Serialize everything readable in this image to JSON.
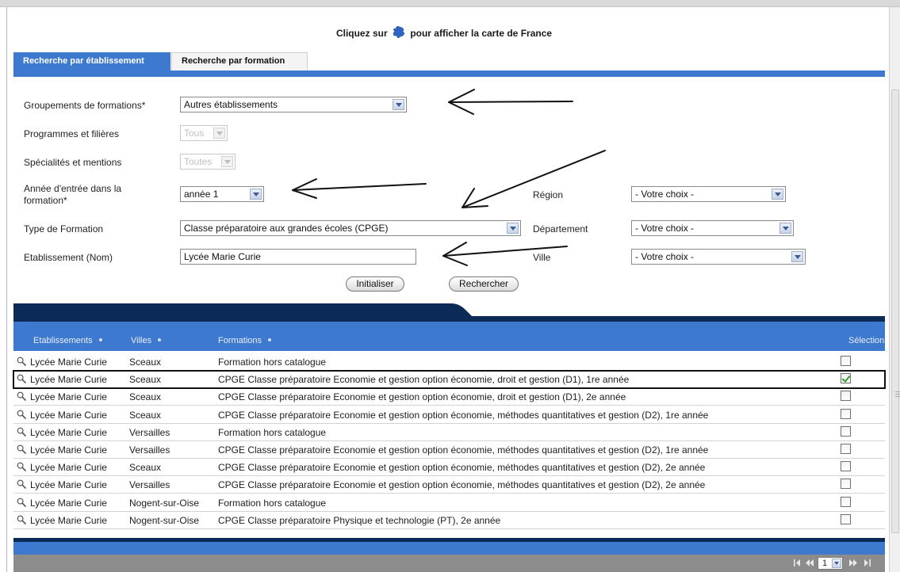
{
  "map_hint": {
    "before": "Cliquez sur",
    "after": "pour afficher la carte de France",
    "icon": "france-map-icon"
  },
  "tabs": [
    {
      "label": "Recherche par établissement",
      "active": true
    },
    {
      "label": "Recherche par formation",
      "active": false
    }
  ],
  "form": {
    "groupements": {
      "label": "Groupements de formations*",
      "value": "Autres établissements"
    },
    "programmes": {
      "label": "Programmes et filières",
      "value": "Tous"
    },
    "specialites": {
      "label": "Spécialités et mentions",
      "value": "Toutes"
    },
    "annee": {
      "label_line1": "Année d'entrée dans la",
      "label_line2": "formation*",
      "value": "année 1"
    },
    "type": {
      "label": "Type de Formation",
      "value": "Classe préparatoire aux grandes écoles (CPGE)"
    },
    "etablissement": {
      "label": "Etablissement (Nom)",
      "value": "Lycée Marie Curie"
    },
    "region": {
      "label": "Région",
      "value": "- Votre choix -"
    },
    "departement": {
      "label": "Département",
      "value": "- Votre choix -"
    },
    "ville": {
      "label": "Ville",
      "value": "- Votre choix -"
    },
    "buttons": {
      "reset": "Initialiser",
      "search": "Rechercher"
    }
  },
  "results": {
    "headers": {
      "etablissements": "Etablissements",
      "villes": "Villes",
      "formations": "Formations",
      "selection": "Sélection"
    },
    "rows": [
      {
        "etab": "Lycée Marie Curie",
        "ville": "Sceaux",
        "formation": "Formation hors catalogue",
        "checked": false
      },
      {
        "etab": "Lycée Marie Curie",
        "ville": "Sceaux",
        "formation": "CPGE Classe préparatoire Economie et gestion option économie, droit et gestion (D1), 1re année",
        "checked": true
      },
      {
        "etab": "Lycée Marie Curie",
        "ville": "Sceaux",
        "formation": "CPGE Classe préparatoire Economie et gestion option économie, droit et gestion (D1), 2e année",
        "checked": false
      },
      {
        "etab": "Lycée Marie Curie",
        "ville": "Sceaux",
        "formation": "CPGE Classe préparatoire Economie et gestion option économie, méthodes quantitatives et gestion (D2), 1re année",
        "checked": false
      },
      {
        "etab": "Lycée Marie Curie",
        "ville": "Versailles",
        "formation": "Formation hors catalogue",
        "checked": false
      },
      {
        "etab": "Lycée Marie Curie",
        "ville": "Versailles",
        "formation": "CPGE Classe préparatoire Economie et gestion option économie, méthodes quantitatives et gestion (D2), 1re année",
        "checked": false
      },
      {
        "etab": "Lycée Marie Curie",
        "ville": "Sceaux",
        "formation": "CPGE Classe préparatoire Economie et gestion option économie, méthodes quantitatives et gestion (D2), 2e année",
        "checked": false
      },
      {
        "etab": "Lycée Marie Curie",
        "ville": "Versailles",
        "formation": "CPGE Classe préparatoire Economie et gestion option économie, méthodes quantitatives et gestion (D2), 2e année",
        "checked": false
      },
      {
        "etab": "Lycée Marie Curie",
        "ville": "Nogent-sur-Oise",
        "formation": "Formation hors catalogue",
        "checked": false
      },
      {
        "etab": "Lycée Marie Curie",
        "ville": "Nogent-sur-Oise",
        "formation": "CPGE Classe préparatoire Physique et technologie (PT), 2e année",
        "checked": false
      }
    ],
    "selected_row_index": 1
  },
  "pager": {
    "page": "1"
  },
  "colors": {
    "accent_blue": "#3d79ce",
    "dark_navy": "#0b2a55",
    "check_green": "#2a9a2a"
  }
}
